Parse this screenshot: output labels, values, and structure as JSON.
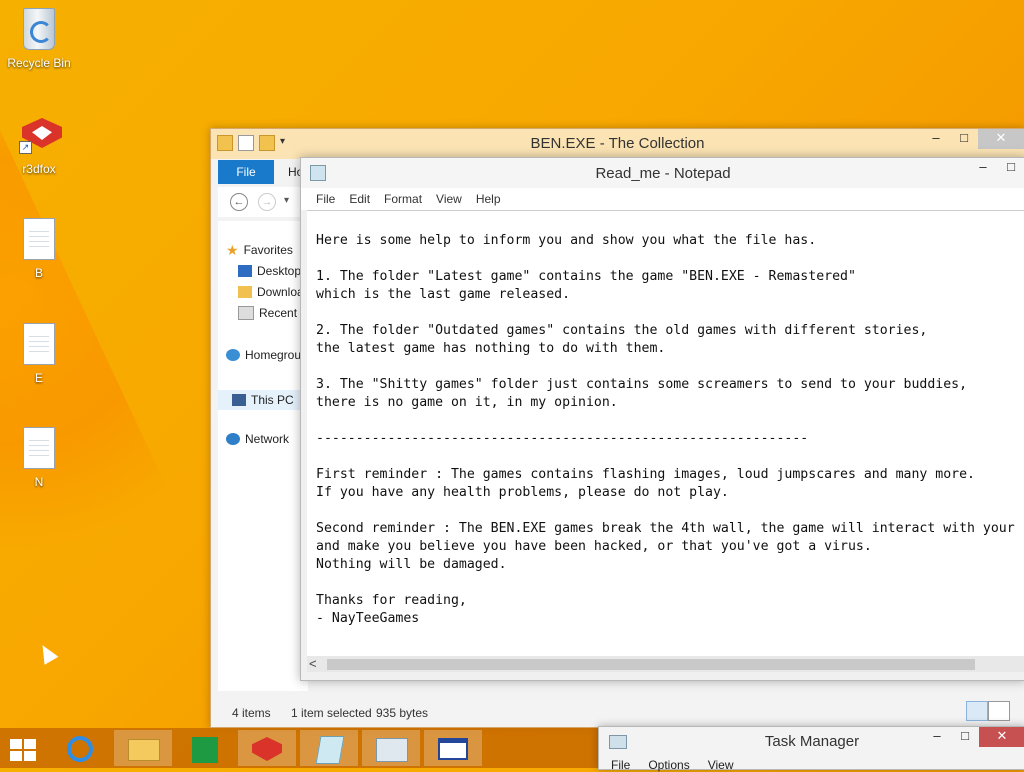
{
  "desktop": {
    "icons": [
      {
        "label": "Recycle Bin",
        "icon": "recycle-bin-icon"
      },
      {
        "label": "r3dfox",
        "icon": "r3dfox-icon"
      },
      {
        "label": "B",
        "icon": "file-icon"
      },
      {
        "label": "E",
        "icon": "file-icon"
      },
      {
        "label": "N",
        "icon": "file-icon"
      }
    ]
  },
  "explorer": {
    "title": "BEN.EXE - The Collection",
    "minimize": "–",
    "maximize": "□",
    "close": "✕",
    "ribbon": {
      "file_tab": "File",
      "home_tab": "Ho"
    },
    "nav": {
      "back": "←",
      "forward": "→"
    },
    "sidebar": [
      {
        "label": "Favorites",
        "icon": "star-icon"
      },
      {
        "label": "Desktop",
        "icon": "desktop-icon"
      },
      {
        "label": "Downloads",
        "icon": "downloads-icon"
      },
      {
        "label": "Recent places",
        "icon": "recent-places-icon"
      },
      {
        "label": "Homegroup",
        "icon": "homegroup-icon"
      },
      {
        "label": "This PC",
        "icon": "pc-icon"
      },
      {
        "label": "Network",
        "icon": "network-icon"
      }
    ],
    "status": {
      "items": "4 items",
      "selected": "1 item selected",
      "size": "935 bytes"
    }
  },
  "notepad": {
    "title": "Read_me - Notepad",
    "minimize": "–",
    "maximize": "□",
    "menu": [
      "File",
      "Edit",
      "Format",
      "View",
      "Help"
    ],
    "content": "Here is some help to inform you and show you what the file has.\n\n1. The folder \"Latest game\" contains the game \"BEN.EXE - Remastered\"\nwhich is the last game released.\n\n2. The folder \"Outdated games\" contains the old games with different stories,\nthe latest game has nothing to do with them.\n\n3. The \"Shitty games\" folder just contains some screamers to send to your buddies,\nthere is no game on it, in my opinion.\n\n--------------------------------------------------------------\n\nFirst reminder : The games contains flashing images, loud jumpscares and many more.\nIf you have any health problems, please do not play.\n\nSecond reminder : The BEN.EXE games break the 4th wall, the game will interact with your\nand make you believe you have been hacked, or that you've got a virus.\nNothing will be damaged.\n\nThanks for reading,\n- NayTeeGames",
    "scroll_left": "<"
  },
  "taskmanager": {
    "title": "Task Manager",
    "menu": [
      "File",
      "Options",
      "View"
    ],
    "minimize": "–",
    "maximize": "□",
    "close": "✕"
  },
  "taskbar": {
    "items": [
      {
        "name": "start-button",
        "icon": "windows-icon"
      },
      {
        "name": "internet-explorer",
        "icon": "internet-explorer-icon"
      },
      {
        "name": "file-explorer",
        "icon": "folder-icon"
      },
      {
        "name": "store",
        "icon": "store-icon"
      },
      {
        "name": "r3dfox",
        "icon": "r3dfox-icon"
      },
      {
        "name": "notepad",
        "icon": "notepad-icon"
      },
      {
        "name": "task-manager",
        "icon": "task-manager-icon"
      },
      {
        "name": "window",
        "icon": "window-icon"
      }
    ]
  },
  "colors": {
    "desktop": "#f6ae00",
    "accent": "#1979ca",
    "taskbar": "#c46800"
  }
}
